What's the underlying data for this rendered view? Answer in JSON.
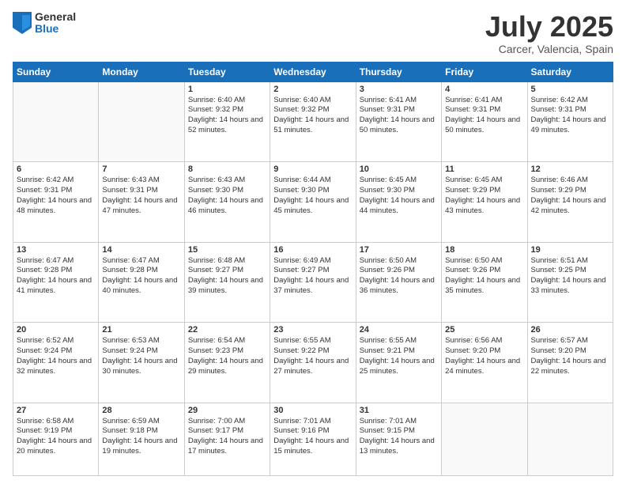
{
  "logo": {
    "general": "General",
    "blue": "Blue"
  },
  "title": "July 2025",
  "subtitle": "Carcer, Valencia, Spain",
  "weekdays": [
    "Sunday",
    "Monday",
    "Tuesday",
    "Wednesday",
    "Thursday",
    "Friday",
    "Saturday"
  ],
  "weeks": [
    [
      {
        "day": "",
        "info": ""
      },
      {
        "day": "",
        "info": ""
      },
      {
        "day": "1",
        "info": "Sunrise: 6:40 AM\nSunset: 9:32 PM\nDaylight: 14 hours and 52 minutes."
      },
      {
        "day": "2",
        "info": "Sunrise: 6:40 AM\nSunset: 9:32 PM\nDaylight: 14 hours and 51 minutes."
      },
      {
        "day": "3",
        "info": "Sunrise: 6:41 AM\nSunset: 9:31 PM\nDaylight: 14 hours and 50 minutes."
      },
      {
        "day": "4",
        "info": "Sunrise: 6:41 AM\nSunset: 9:31 PM\nDaylight: 14 hours and 50 minutes."
      },
      {
        "day": "5",
        "info": "Sunrise: 6:42 AM\nSunset: 9:31 PM\nDaylight: 14 hours and 49 minutes."
      }
    ],
    [
      {
        "day": "6",
        "info": "Sunrise: 6:42 AM\nSunset: 9:31 PM\nDaylight: 14 hours and 48 minutes."
      },
      {
        "day": "7",
        "info": "Sunrise: 6:43 AM\nSunset: 9:31 PM\nDaylight: 14 hours and 47 minutes."
      },
      {
        "day": "8",
        "info": "Sunrise: 6:43 AM\nSunset: 9:30 PM\nDaylight: 14 hours and 46 minutes."
      },
      {
        "day": "9",
        "info": "Sunrise: 6:44 AM\nSunset: 9:30 PM\nDaylight: 14 hours and 45 minutes."
      },
      {
        "day": "10",
        "info": "Sunrise: 6:45 AM\nSunset: 9:30 PM\nDaylight: 14 hours and 44 minutes."
      },
      {
        "day": "11",
        "info": "Sunrise: 6:45 AM\nSunset: 9:29 PM\nDaylight: 14 hours and 43 minutes."
      },
      {
        "day": "12",
        "info": "Sunrise: 6:46 AM\nSunset: 9:29 PM\nDaylight: 14 hours and 42 minutes."
      }
    ],
    [
      {
        "day": "13",
        "info": "Sunrise: 6:47 AM\nSunset: 9:28 PM\nDaylight: 14 hours and 41 minutes."
      },
      {
        "day": "14",
        "info": "Sunrise: 6:47 AM\nSunset: 9:28 PM\nDaylight: 14 hours and 40 minutes."
      },
      {
        "day": "15",
        "info": "Sunrise: 6:48 AM\nSunset: 9:27 PM\nDaylight: 14 hours and 39 minutes."
      },
      {
        "day": "16",
        "info": "Sunrise: 6:49 AM\nSunset: 9:27 PM\nDaylight: 14 hours and 37 minutes."
      },
      {
        "day": "17",
        "info": "Sunrise: 6:50 AM\nSunset: 9:26 PM\nDaylight: 14 hours and 36 minutes."
      },
      {
        "day": "18",
        "info": "Sunrise: 6:50 AM\nSunset: 9:26 PM\nDaylight: 14 hours and 35 minutes."
      },
      {
        "day": "19",
        "info": "Sunrise: 6:51 AM\nSunset: 9:25 PM\nDaylight: 14 hours and 33 minutes."
      }
    ],
    [
      {
        "day": "20",
        "info": "Sunrise: 6:52 AM\nSunset: 9:24 PM\nDaylight: 14 hours and 32 minutes."
      },
      {
        "day": "21",
        "info": "Sunrise: 6:53 AM\nSunset: 9:24 PM\nDaylight: 14 hours and 30 minutes."
      },
      {
        "day": "22",
        "info": "Sunrise: 6:54 AM\nSunset: 9:23 PM\nDaylight: 14 hours and 29 minutes."
      },
      {
        "day": "23",
        "info": "Sunrise: 6:55 AM\nSunset: 9:22 PM\nDaylight: 14 hours and 27 minutes."
      },
      {
        "day": "24",
        "info": "Sunrise: 6:55 AM\nSunset: 9:21 PM\nDaylight: 14 hours and 25 minutes."
      },
      {
        "day": "25",
        "info": "Sunrise: 6:56 AM\nSunset: 9:20 PM\nDaylight: 14 hours and 24 minutes."
      },
      {
        "day": "26",
        "info": "Sunrise: 6:57 AM\nSunset: 9:20 PM\nDaylight: 14 hours and 22 minutes."
      }
    ],
    [
      {
        "day": "27",
        "info": "Sunrise: 6:58 AM\nSunset: 9:19 PM\nDaylight: 14 hours and 20 minutes."
      },
      {
        "day": "28",
        "info": "Sunrise: 6:59 AM\nSunset: 9:18 PM\nDaylight: 14 hours and 19 minutes."
      },
      {
        "day": "29",
        "info": "Sunrise: 7:00 AM\nSunset: 9:17 PM\nDaylight: 14 hours and 17 minutes."
      },
      {
        "day": "30",
        "info": "Sunrise: 7:01 AM\nSunset: 9:16 PM\nDaylight: 14 hours and 15 minutes."
      },
      {
        "day": "31",
        "info": "Sunrise: 7:01 AM\nSunset: 9:15 PM\nDaylight: 14 hours and 13 minutes."
      },
      {
        "day": "",
        "info": ""
      },
      {
        "day": "",
        "info": ""
      }
    ]
  ]
}
